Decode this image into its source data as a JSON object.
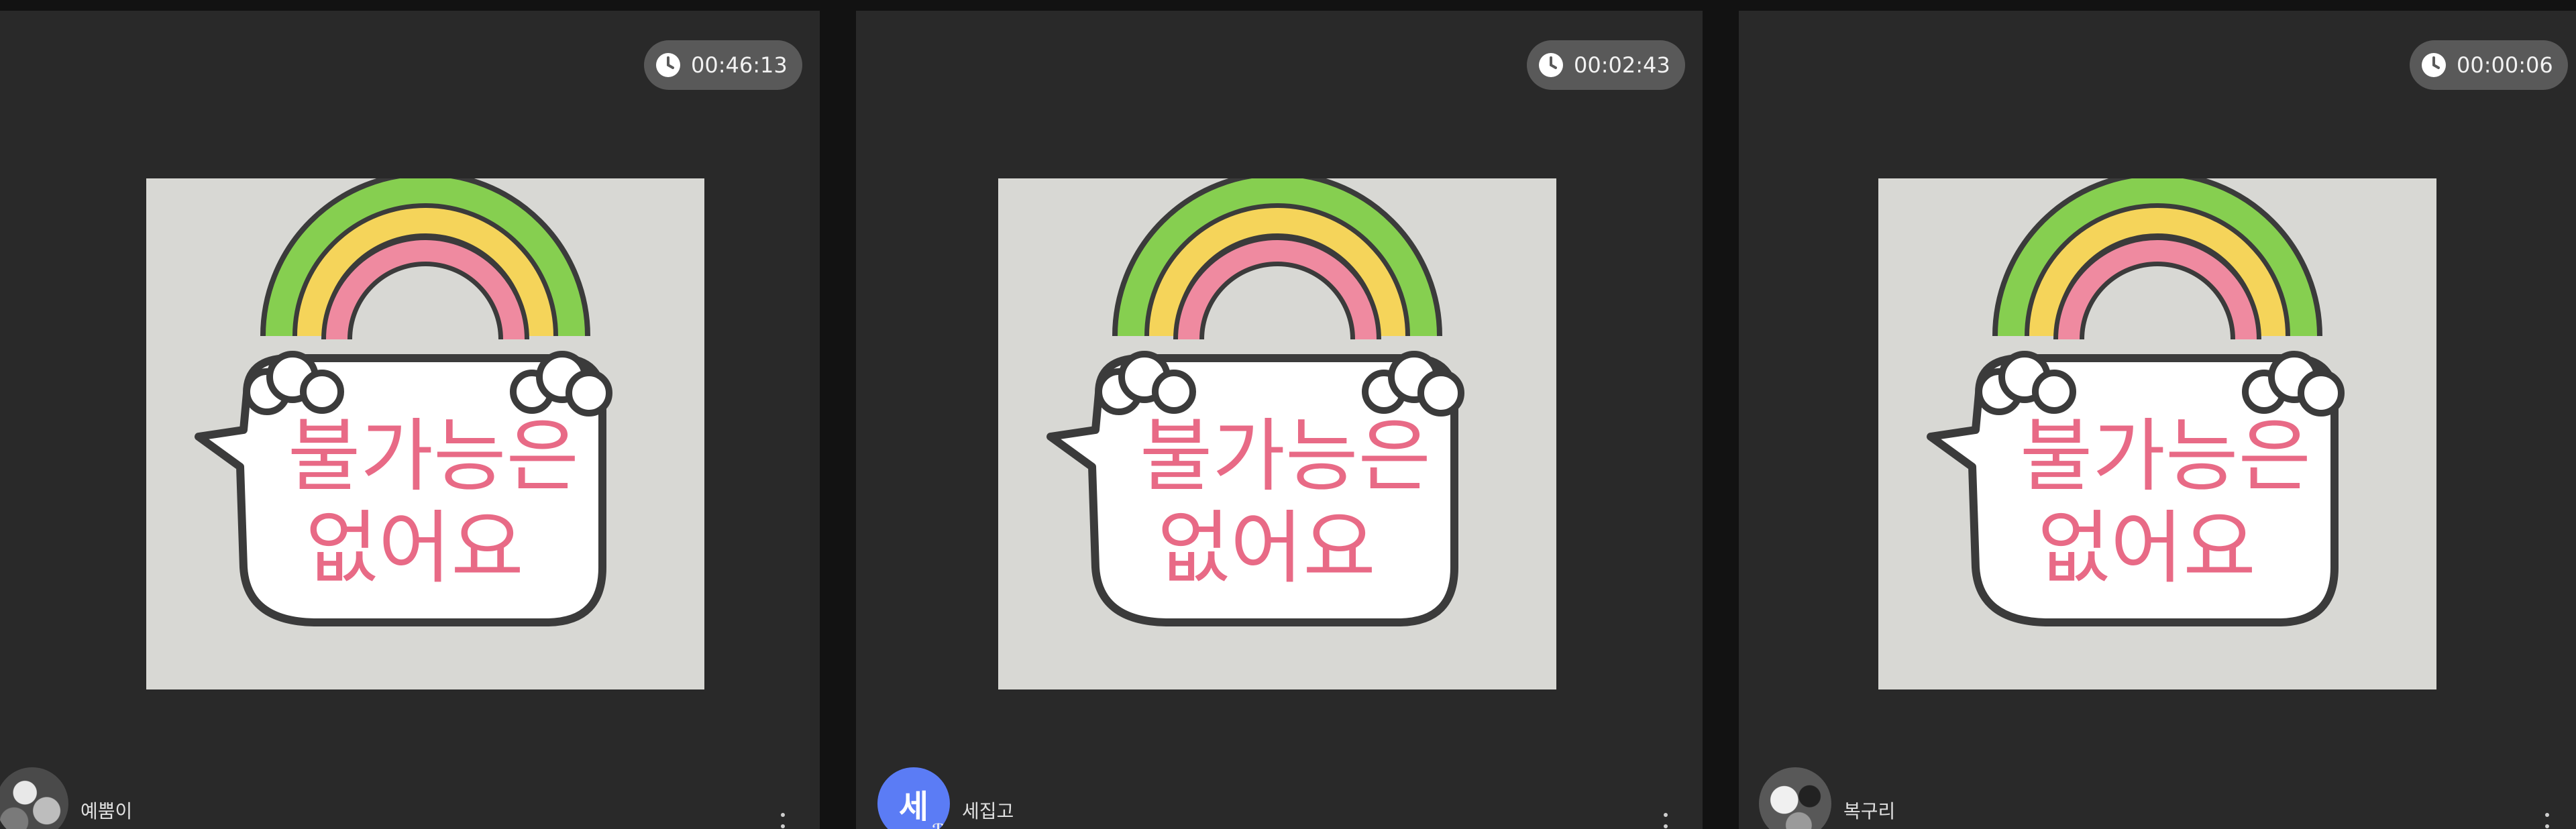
{
  "cards": [
    {
      "timer": "00:46:13",
      "sticker_line1": "불가능은",
      "sticker_line2": "없어요",
      "user": {
        "name": "예뿜이",
        "avatar": "photo"
      }
    },
    {
      "timer": "00:02:43",
      "sticker_line1": "불가능은",
      "sticker_line2": "없어요",
      "user": {
        "name": "세집고",
        "avatar": "letter",
        "initial": "세",
        "badge": "ℛ"
      }
    },
    {
      "timer": "00:00:06",
      "sticker_line1": "불가능은",
      "sticker_line2": "없어요",
      "user": {
        "name": "복구리",
        "avatar": "photo"
      }
    }
  ],
  "icons": {
    "timer": "clock-icon",
    "menu": "more-vertical-icon"
  },
  "colors": {
    "background": "#121212",
    "card": "#292929",
    "timer_pill": "#595959",
    "sticker_bg": "#d8d8d4",
    "pink_text": "#e86a86",
    "avatar_letter": "#5b7cf5"
  }
}
